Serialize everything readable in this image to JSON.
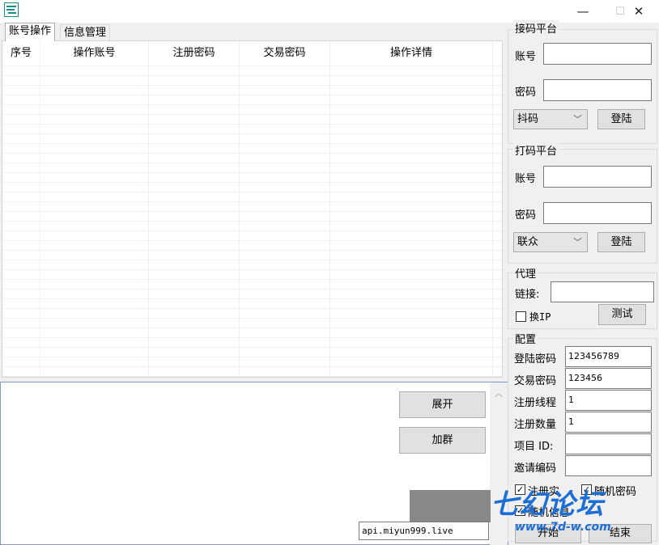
{
  "window": {
    "minimize_glyph": "—",
    "maximize_glyph": "☐",
    "close_glyph": "✕"
  },
  "tabs": [
    {
      "label": "账号操作",
      "active": true
    },
    {
      "label": "信息管理",
      "active": false
    }
  ],
  "table": {
    "columns": [
      "序号",
      "操作账号",
      "注册密码",
      "交易密码",
      "操作详情"
    ]
  },
  "bottom": {
    "expand_label": "展开",
    "group_label": "加群",
    "api_value": "api.miyun999.live"
  },
  "receive_platform": {
    "title": "接码平台",
    "account_label": "账号",
    "password_label": "密码",
    "platform_selected": "抖码",
    "login_label": "登陆"
  },
  "captcha_platform": {
    "title": "打码平台",
    "account_label": "账号",
    "password_label": "密码",
    "platform_selected": "联众",
    "login_label": "登陆"
  },
  "proxy": {
    "title": "代理",
    "link_label": "链接:",
    "swap_ip_label": "换IP",
    "test_label": "测试"
  },
  "config": {
    "title": "配置",
    "login_password_label": "登陆密码",
    "login_password_value": "123456789",
    "trade_password_label": "交易密码",
    "trade_password_value": "123456",
    "register_threads_label": "注册线程",
    "register_threads_value": "1",
    "register_count_label": "注册数量",
    "register_count_value": "1",
    "project_id_label": "项目 ID:",
    "invite_code_label": "邀请编码",
    "opt1_label": "注册实",
    "opt2_label": "随机密码",
    "opt3_label": "随机信息",
    "start_label": "开始",
    "stop_label": "结束"
  },
  "watermark": {
    "line1": "七幻论坛",
    "line2": "www.7d-w.com"
  }
}
